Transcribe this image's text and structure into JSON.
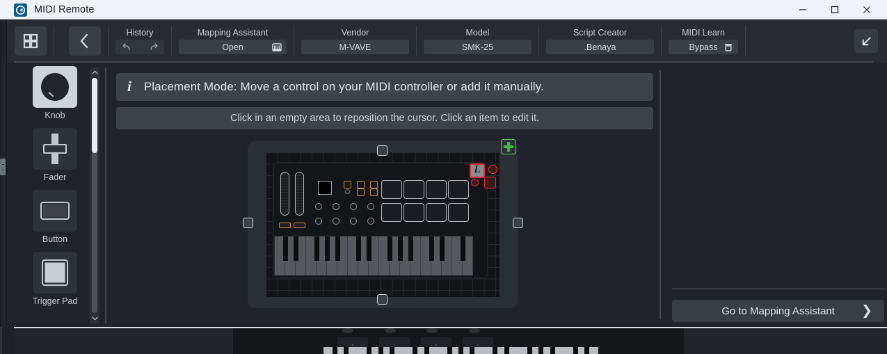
{
  "window": {
    "title": "MIDI Remote",
    "app_icon": "cubase-logo-icon",
    "controls": {
      "minimize": "minimize-icon",
      "maximize": "maximize-icon",
      "close": "close-icon"
    }
  },
  "toolbar": {
    "grid_view_icon": "grid-view-icon",
    "back_icon": "chevron-left-icon",
    "collapse_icon": "collapse-down-left-icon",
    "groups": [
      {
        "label": "History",
        "kind": "history",
        "undo_icon": "undo-icon",
        "redo_icon": "redo-icon"
      },
      {
        "label": "Mapping Assistant",
        "value": "Open",
        "icon": "piano-keys-icon"
      },
      {
        "label": "Vendor",
        "value": "M-VAVE"
      },
      {
        "label": "Model",
        "value": "SMK-25"
      },
      {
        "label": "Script Creator",
        "value": ".Benaya"
      },
      {
        "label": "MIDI Learn",
        "value": "Bypass",
        "icon": "bypass-trash-icon"
      }
    ]
  },
  "sidebar": {
    "items": [
      {
        "label": "Knob",
        "icon": "knob-icon",
        "selected": true
      },
      {
        "label": "Fader",
        "icon": "fader-icon",
        "selected": false
      },
      {
        "label": "Button",
        "icon": "button-icon",
        "selected": false
      },
      {
        "label": "Trigger Pad",
        "icon": "trigger-pad-icon",
        "selected": false
      }
    ],
    "scroll_up_icon": "chevron-up-icon",
    "scroll_down_icon": "chevron-down-icon"
  },
  "center": {
    "info_banner": {
      "icon": "info-italic-i-icon",
      "text": "Placement Mode: Move a control on your MIDI controller or add it manually."
    },
    "hint_banner": {
      "text": "Click in an empty area to reposition the cursor. Click an item to edit it."
    },
    "device": {
      "add_button_icon": "add-plus-icon",
      "cursor_glyph": "L",
      "cursor_name": "midi-learn-cursor",
      "selected_color": "#e2303a",
      "accent_color": "#c98a3e",
      "add_color": "#3fba3f"
    }
  },
  "right_panel": {
    "goto_button": {
      "label": "Go to Mapping Assistant",
      "chevron": "❯"
    }
  }
}
